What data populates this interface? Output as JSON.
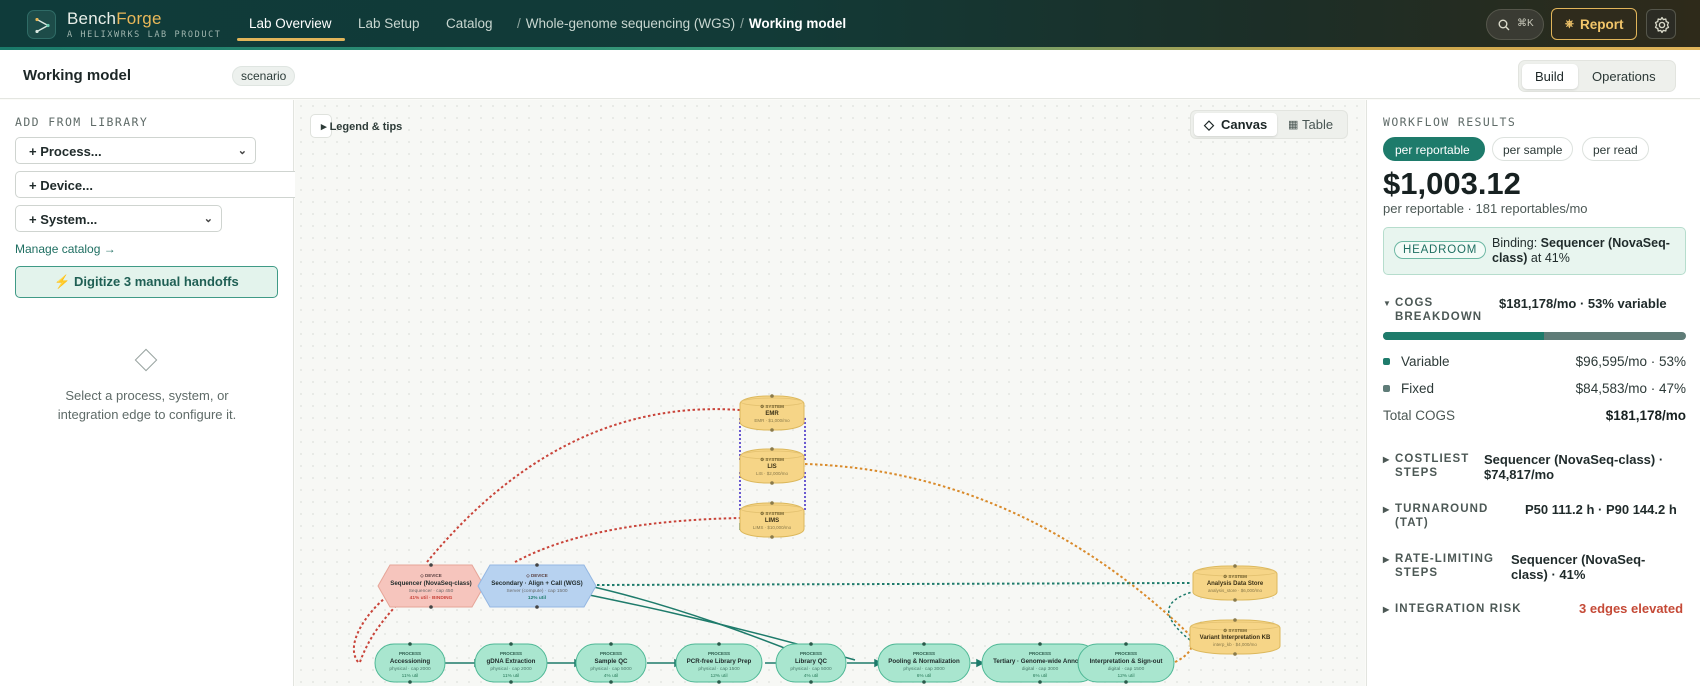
{
  "app": {
    "brand_main": "Bench",
    "brand_accent": "Forge",
    "brand_subtitle": "A HELIXWRKS LAB PRODUCT",
    "accent_color": "#e1b55a",
    "primary_color": "#1e7b6b"
  },
  "nav": {
    "tabs": [
      {
        "label": "Lab Overview",
        "active": true
      },
      {
        "label": "Lab Setup",
        "active": false
      },
      {
        "label": "Catalog",
        "active": false
      }
    ],
    "breadcrumb": {
      "sep": "/",
      "project": "Whole-genome sequencing (WGS)",
      "current": "Working model"
    },
    "search_shortcut": "⌘K",
    "report_label": "Report"
  },
  "subheader": {
    "title": "Working model",
    "badge": "scenario",
    "modes": [
      {
        "label": "Build",
        "active": true
      },
      {
        "label": "Operations",
        "active": false
      }
    ]
  },
  "library": {
    "title": "ADD FROM LIBRARY",
    "process": "+ Process...",
    "device": "+ Device...",
    "system": "+ System...",
    "manage": "Manage catalog →",
    "digitize": "⚡ Digitize 3 manual handoffs",
    "empty_text": "Select a process, system, or integration edge to configure it."
  },
  "canvas": {
    "legend": "▸ Legend & tips",
    "views": [
      {
        "label": "Canvas",
        "icon": "diamond-icon",
        "active": true
      },
      {
        "label": "Table",
        "icon": "table-icon",
        "active": false
      }
    ],
    "systems": [
      {
        "kind": "⚙ SYSTEM",
        "name": "EMR",
        "detail": "EMR · $1,000/mo"
      },
      {
        "kind": "⚙ SYSTEM",
        "name": "LIS",
        "detail": "LIS · $2,000/mo"
      },
      {
        "kind": "⚙ SYSTEM",
        "name": "LIMS",
        "detail": "LIMS · $10,000/mo"
      },
      {
        "kind": "⚙ SYSTEM",
        "name": "Analysis Data Store",
        "detail": "analysis_store · $6,000/mo"
      },
      {
        "kind": "⚙ SYSTEM",
        "name": "Variant Interpretation KB",
        "detail": "interp_kb · $4,000/mo"
      }
    ],
    "devices": [
      {
        "kind": "◇ DEVICE",
        "name": "Sequencer (NovaSeq-class)",
        "detail": "Sequencer · cap 450",
        "util": "41% util · BINDING"
      },
      {
        "kind": "◇ DEVICE",
        "name": "Secondary · Align + Call (WGS)",
        "detail": "Server (compute) · cap 1500",
        "util": "12% util"
      }
    ],
    "processes": [
      {
        "kind": "PROCESS",
        "name": "Accessioning",
        "detail": "physical · cap 2000",
        "util": "11% util"
      },
      {
        "kind": "PROCESS",
        "name": "gDNA Extraction",
        "detail": "physical · cap 2000",
        "util": "11% util"
      },
      {
        "kind": "PROCESS",
        "name": "Sample QC",
        "detail": "physical · cap 5000",
        "util": "4% util"
      },
      {
        "kind": "PROCESS",
        "name": "PCR-free Library Prep",
        "detail": "physical · cap 1500",
        "util": "12% util"
      },
      {
        "kind": "PROCESS",
        "name": "Library QC",
        "detail": "physical · cap 5000",
        "util": "4% util"
      },
      {
        "kind": "PROCESS",
        "name": "Pooling & Normalization",
        "detail": "physical · cap 3000",
        "util": "6% util"
      },
      {
        "kind": "PROCESS",
        "name": "Tertiary · Genome-wide Annot…",
        "detail": "digital · cap 3000",
        "util": "6% util"
      },
      {
        "kind": "PROCESS",
        "name": "Interpretation & Sign-out",
        "detail": "digital · cap 1500",
        "util": "12% util"
      }
    ]
  },
  "results": {
    "title": "WORKFLOW RESULTS",
    "units": [
      {
        "label": "per reportable",
        "active": true
      },
      {
        "label": "per sample",
        "active": false
      },
      {
        "label": "per read",
        "active": false
      }
    ],
    "cost": "$1,003.12",
    "cost_sub": "per reportable · 181 reportables/mo",
    "headroom_badge": "HEADROOM",
    "headroom_prefix": "Binding: ",
    "headroom_name": "Sequencer (NovaSeq-class)",
    "headroom_suffix": " at 41%",
    "cogs_label": "COGS BREAKDOWN",
    "cogs_value": "$181,178/mo · 53% variable",
    "cogs_variable_share": 0.53,
    "variable_label": "Variable",
    "variable_value": "$96,595/mo · 53%",
    "variable_color": "#1e7b6b",
    "fixed_label": "Fixed",
    "fixed_value": "$84,583/mo · 47%",
    "fixed_color": "#5f7c78",
    "total_label": "Total COGS",
    "total_value": "$181,178/mo",
    "costliest_label": "COSTLIEST STEPS",
    "costliest_value": "Sequencer (NovaSeq-class) · $74,817/mo",
    "tat_label": "TURNAROUND (TAT)",
    "tat_value": "P50 111.2 h · P90 144.2 h",
    "rate_label": "RATE-LIMITING STEPS",
    "rate_value": "Sequencer (NovaSeq-class) · 41%",
    "risk_label": "INTEGRATION RISK",
    "risk_value": "3 edges elevated",
    "risk_color": "#c54a37"
  }
}
